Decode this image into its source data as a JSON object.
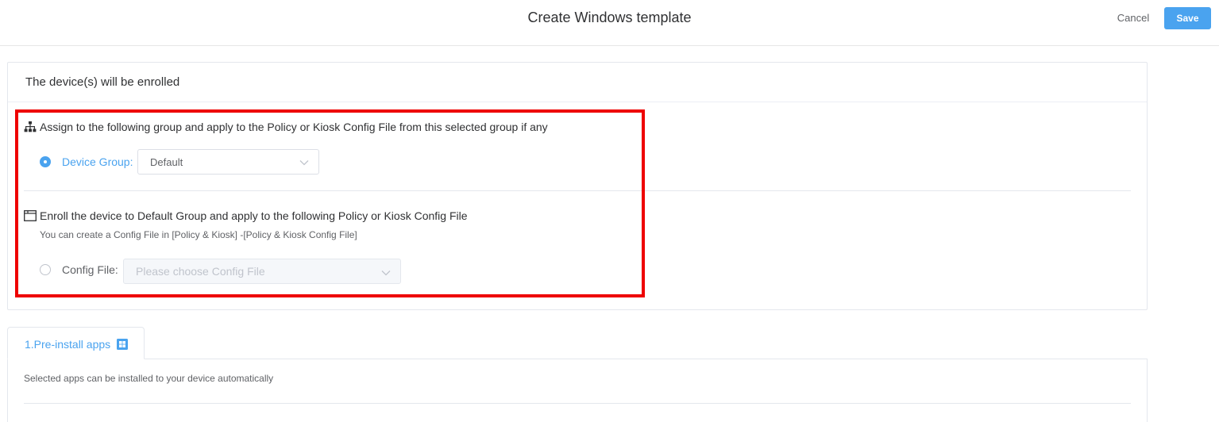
{
  "header": {
    "title": "Create Windows template",
    "cancel_label": "Cancel",
    "save_label": "Save"
  },
  "enroll": {
    "title": "The device(s) will be enrolled",
    "option_group": {
      "heading": "Assign to the following group and apply to the Policy or Kiosk Config File from this selected group if any",
      "icon": "sitemap-icon",
      "selected": true,
      "field_label": "Device Group:",
      "value": "Default"
    },
    "option_config": {
      "heading": "Enroll the device to Default Group and apply to the following Policy or Kiosk Config File",
      "icon": "folder-icon",
      "hint": "You can create a Config File in [Policy & Kiosk] -[Policy & Kiosk Config File]",
      "selected": false,
      "field_label": "Config File:",
      "placeholder": "Please choose Config File"
    }
  },
  "tabs": [
    {
      "label": "1.Pre-install apps",
      "icon": "windows-icon",
      "active": true,
      "description": "Selected apps can be installed to your device automatically"
    }
  ],
  "colors": {
    "accent": "#4aa3ef",
    "highlight": "#ee0000"
  }
}
